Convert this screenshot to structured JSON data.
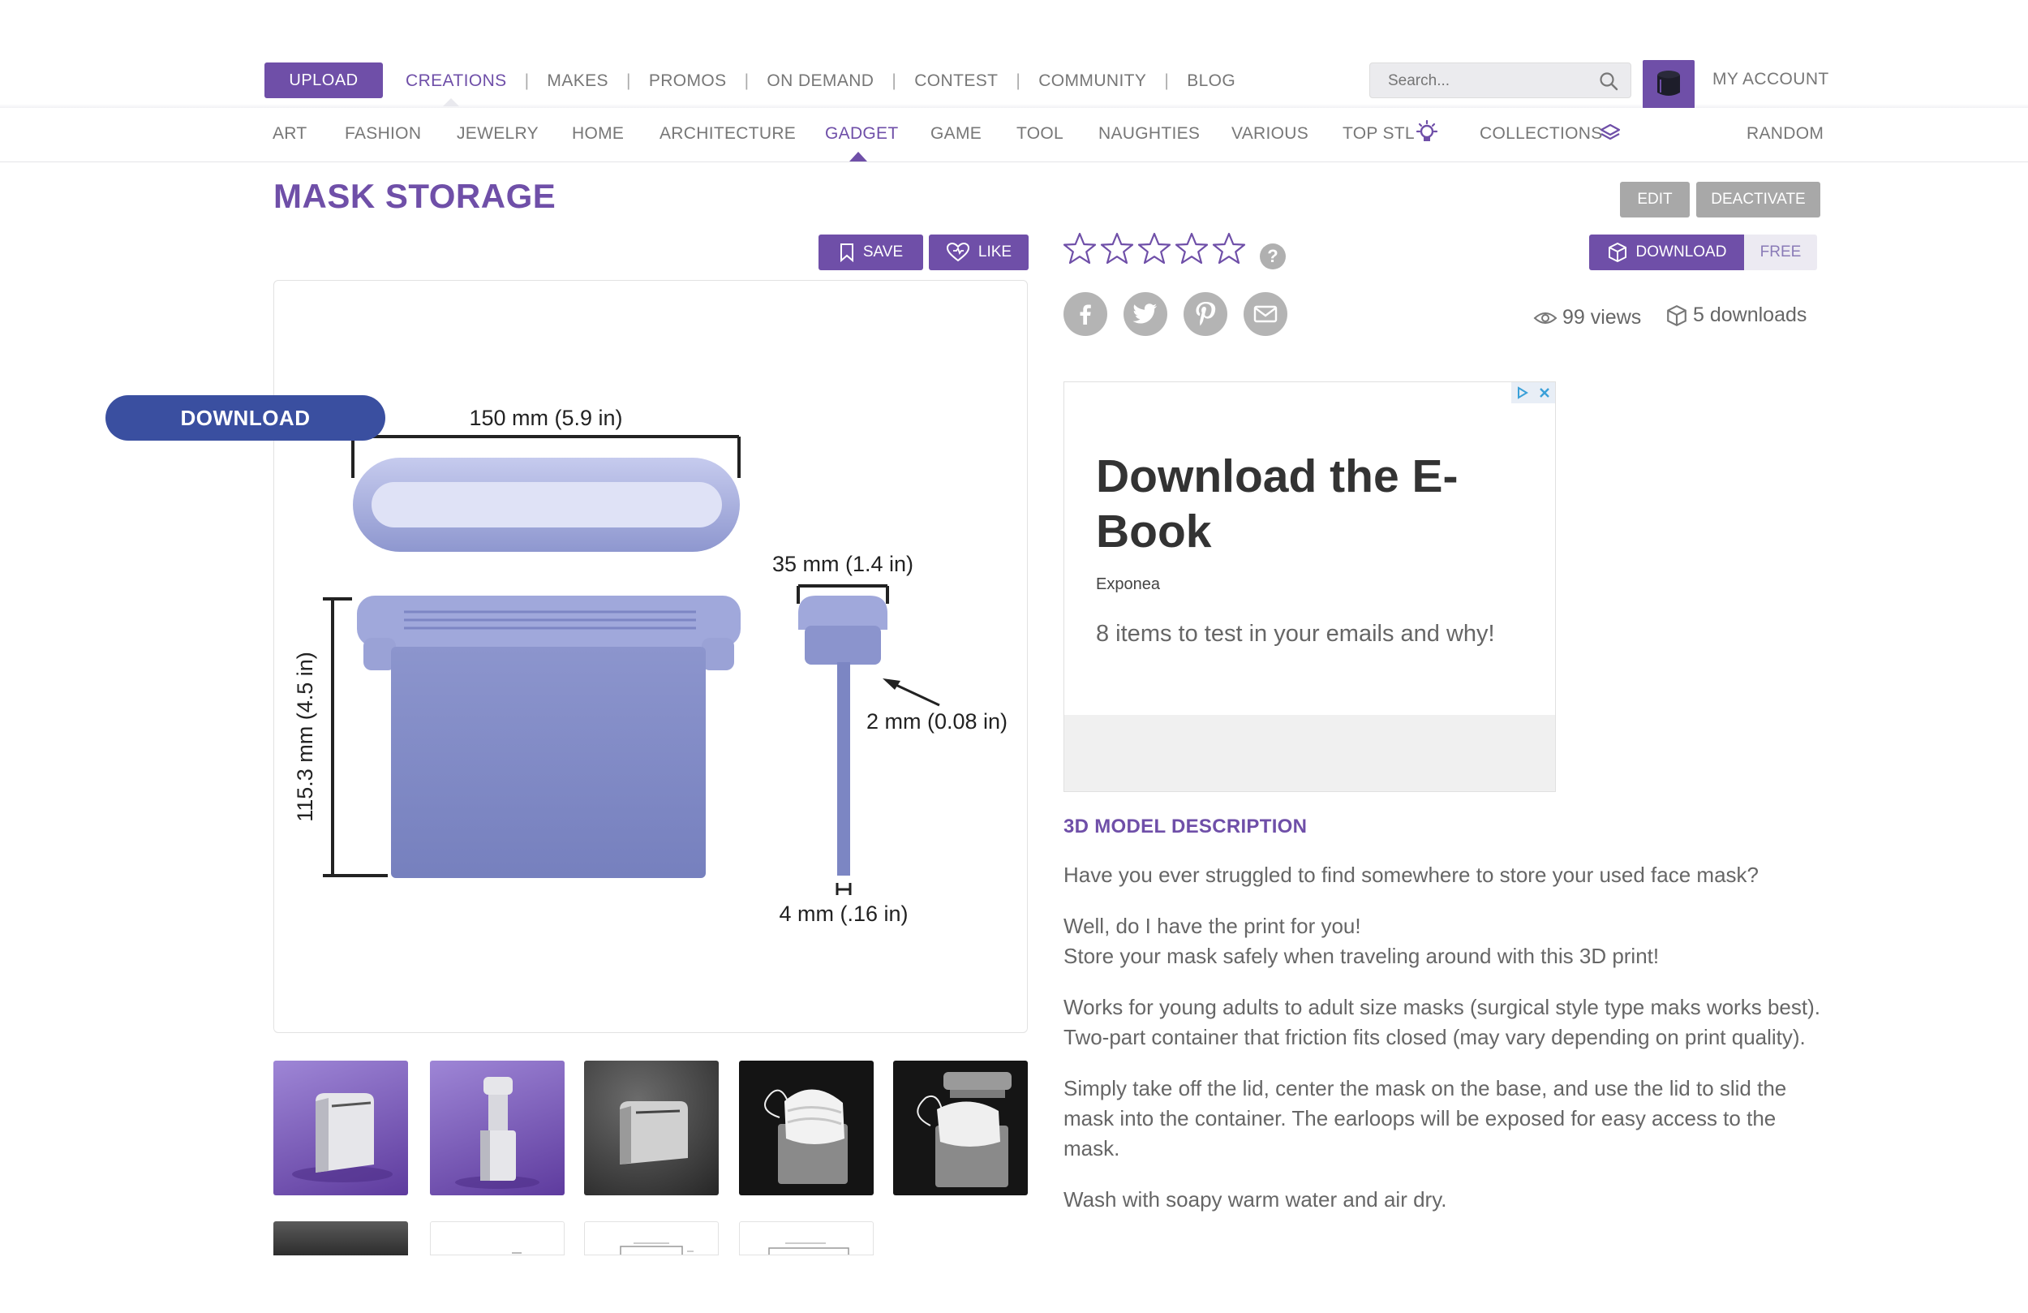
{
  "header": {
    "upload_label": "UPLOAD",
    "nav": [
      {
        "label": "CREATIONS",
        "active": true
      },
      {
        "label": "MAKES",
        "active": false
      },
      {
        "label": "PROMOS",
        "active": false
      },
      {
        "label": "ON DEMAND",
        "active": false
      },
      {
        "label": "CONTEST",
        "active": false
      },
      {
        "label": "COMMUNITY",
        "active": false
      },
      {
        "label": "BLOG",
        "active": false
      }
    ],
    "search_placeholder": "Search...",
    "account_label": "MY ACCOUNT",
    "accent": "#6f4fa8"
  },
  "categories": {
    "items": [
      "ART",
      "FASHION",
      "JEWELRY",
      "HOME",
      "ARCHITECTURE",
      "GADGET",
      "GAME",
      "TOOL",
      "NAUGHTIES",
      "VARIOUS",
      "TOP STL",
      "COLLECTIONS"
    ],
    "active": "GADGET",
    "random_label": "RANDOM"
  },
  "product": {
    "title": "MASK STORAGE",
    "edit_label": "EDIT",
    "deactivate_label": "DEACTIVATE",
    "save_label": "SAVE",
    "like_label": "LIKE",
    "download_label": "DOWNLOAD",
    "price_label": "FREE",
    "rating_stars": 0,
    "rating_max": 5,
    "help_label": "?",
    "views": "99 views",
    "downloads": "5 downloads",
    "social": [
      "facebook-icon",
      "twitter-icon",
      "pinterest-icon",
      "email-icon"
    ]
  },
  "image": {
    "dim_width": "150 mm (5.9 in)",
    "dim_height": "115.3 mm (4.5 in)",
    "dim_pin_width": "35 mm (1.4 in)",
    "dim_pin_thick": "2 mm (0.08 in)",
    "dim_pin_base": "4 mm (.16 in)"
  },
  "ad": {
    "headline": "Download the E-Book",
    "brand": "Exponea",
    "text": "8 items to test in your emails and why!",
    "cta": "DOWNLOAD"
  },
  "description": {
    "heading": "3D MODEL DESCRIPTION",
    "p1": "Have you ever struggled to find somewhere to store your used face mask?",
    "p2a": "Well, do I have the print for you!",
    "p2b": "Store your mask safely when traveling around with this 3D print!",
    "p3": "Works for young adults to adult size masks (surgical style type maks works best). Two-part container that friction fits closed (may vary depending on print quality).",
    "p4": "Simply take off the lid, center the mask on the base, and use the lid to slid the mask into the container. The earloops will be exposed for easy access to the mask.",
    "p5": "Wash with soapy warm water and air dry."
  }
}
